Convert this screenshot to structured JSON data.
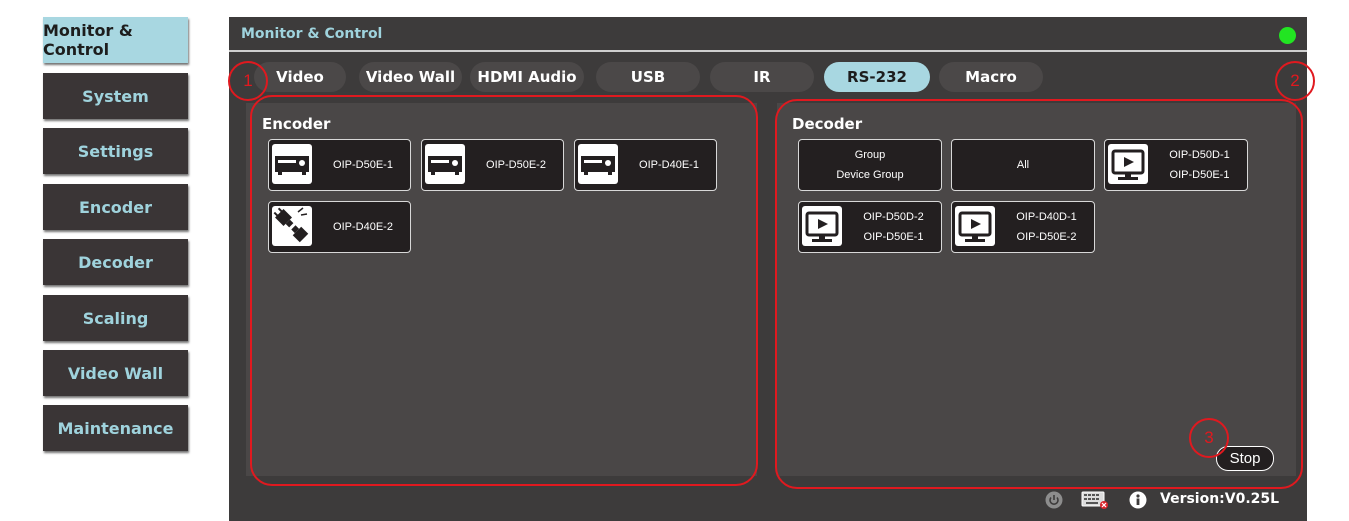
{
  "sidebar": {
    "items": [
      {
        "label": "Monitor & Control",
        "active": true
      },
      {
        "label": "System"
      },
      {
        "label": "Settings"
      },
      {
        "label": "Encoder"
      },
      {
        "label": "Decoder"
      },
      {
        "label": "Scaling"
      },
      {
        "label": "Video Wall"
      },
      {
        "label": "Maintenance"
      }
    ]
  },
  "header": {
    "title": "Monitor & Control",
    "status_color": "#22e522"
  },
  "tabs": [
    {
      "label": "Video"
    },
    {
      "label": "Video Wall"
    },
    {
      "label": "HDMI Audio"
    },
    {
      "label": "USB"
    },
    {
      "label": "IR"
    },
    {
      "label": "RS-232",
      "active": true
    },
    {
      "label": "Macro"
    }
  ],
  "encoder": {
    "title": "Encoder",
    "devices": [
      {
        "name": "OIP-D50E-1",
        "icon": "encoder-device-icon"
      },
      {
        "name": "OIP-D50E-2",
        "icon": "encoder-device-icon"
      },
      {
        "name": "OIP-D40E-1",
        "icon": "encoder-device-icon"
      },
      {
        "name": "OIP-D40E-2",
        "icon": "disconnected-plug-icon"
      }
    ]
  },
  "decoder": {
    "title": "Decoder",
    "group_button": {
      "line1": "Group",
      "line2": "Device Group"
    },
    "all_button": {
      "label": "All"
    },
    "devices": [
      {
        "name": "OIP-D50D-1",
        "source": "OIP-D50E-1",
        "icon": "display-play-icon"
      },
      {
        "name": "OIP-D50D-2",
        "source": "OIP-D50E-1",
        "icon": "display-play-icon"
      },
      {
        "name": "OIP-D40D-1",
        "source": "OIP-D50E-2",
        "icon": "display-play-icon"
      }
    ],
    "stop_label": "Stop"
  },
  "annotations": [
    "1",
    "2",
    "3"
  ],
  "footer": {
    "icons": [
      "power-icon",
      "keyboard-icon",
      "info-icon"
    ],
    "version": "Version:V0.25L"
  },
  "colors": {
    "accent": "#a8d7e1",
    "annotation": "#e0191f",
    "panel": "#4a4747",
    "background": "#3d3b3b"
  }
}
